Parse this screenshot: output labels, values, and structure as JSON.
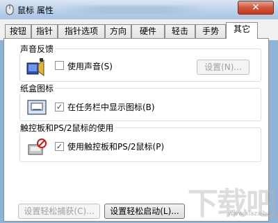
{
  "window": {
    "title": "鼠标 属性",
    "close_label": "✕"
  },
  "tabs": [
    {
      "label": "按钮"
    },
    {
      "label": "指针"
    },
    {
      "label": "指针选项"
    },
    {
      "label": "方向"
    },
    {
      "label": "硬件"
    },
    {
      "label": "轻击"
    },
    {
      "label": "手势"
    },
    {
      "label": "其它"
    }
  ],
  "active_tab": "其它",
  "groups": {
    "sound": {
      "title": "声音反馈",
      "checkbox_label": "使用声音(S)",
      "checked": false,
      "settings_button": "设置(N)..."
    },
    "tray": {
      "title": "纸盒图标",
      "checkbox_label": "在任务栏中显示图标(B)",
      "checked": true
    },
    "touchpad": {
      "title": "触控板和PS/2鼠标的使用",
      "checkbox_label": "使用触控板和PS/2鼠标(P)",
      "checked": true
    }
  },
  "bottom": {
    "capture_button": "设置轻松捕获(C)...",
    "launch_button": "设置轻松启动(L)..."
  },
  "watermark": {
    "text": "下载吧",
    "url": "www.xiazaiba.com"
  }
}
